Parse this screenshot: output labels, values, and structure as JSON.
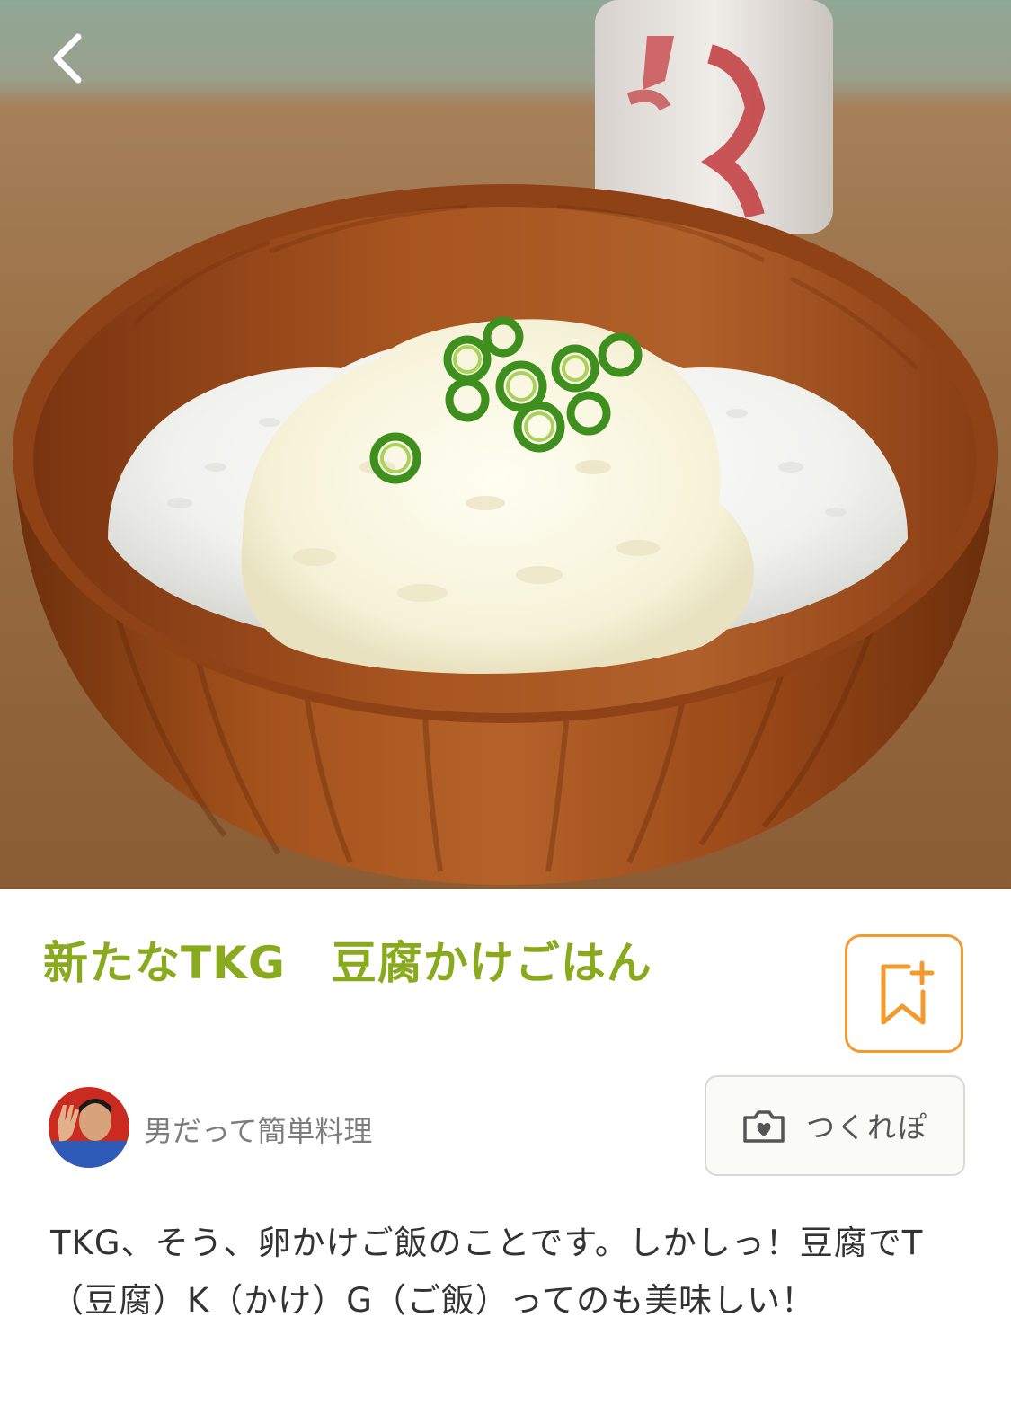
{
  "header": {
    "back_icon": "chevron-left-icon"
  },
  "hero": {
    "description_icon": "food-photo"
  },
  "recipe": {
    "title": "新たなTKG　豆腐かけごはん",
    "bookmark_icon": "bookmark-plus-icon",
    "author_name": "男だって簡単料理",
    "tsukurepo_label": "つくれぽ",
    "tsukurepo_icon": "camera-heart-icon",
    "description": "TKG、そう、卵かけご飯のことです。しかしっ！豆腐でT（豆腐）K（かけ）G（ご飯）ってのも美味しい！"
  },
  "colors": {
    "title": "#8aaa1e",
    "accent_orange": "#f29a2e",
    "text": "#333333",
    "muted": "#7d7d7d"
  }
}
